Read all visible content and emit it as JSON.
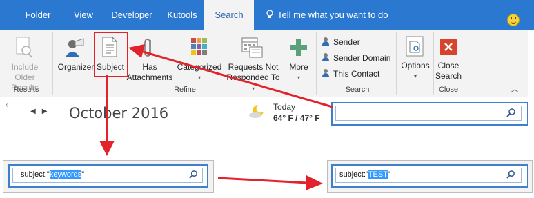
{
  "tabs": [
    {
      "label": "Folder",
      "active": false
    },
    {
      "label": "View",
      "active": false
    },
    {
      "label": "Developer",
      "active": false
    },
    {
      "label": "Kutools",
      "active": false
    },
    {
      "label": "Search",
      "active": true
    }
  ],
  "tell_me": "Tell me what you want to do",
  "results_group": {
    "label": "Results",
    "include_older": {
      "line1": "Include",
      "line2": "Older Results"
    }
  },
  "refine_group": {
    "label": "Refine",
    "organizer": "Organizer",
    "subject": "Subject",
    "has_attachments": {
      "line1": "Has",
      "line2": "Attachments"
    },
    "categorized": "Categorized",
    "requests_not_responded": {
      "line1": "Requests Not",
      "line2": "Responded To"
    },
    "more": "More"
  },
  "search_group": {
    "label": "Search",
    "sender": "Sender",
    "sender_domain": "Sender Domain",
    "this_contact": "This Contact"
  },
  "options_button": "Options",
  "close_group": {
    "label": "Close",
    "close_search": {
      "line1": "Close",
      "line2": "Search"
    }
  },
  "calendar": {
    "month": "October 2016"
  },
  "weather": {
    "today": "Today",
    "temps": "64° F / 47° F"
  },
  "search_examples": {
    "left": {
      "prefix": "subject:\"",
      "keyword": "keywords",
      "suffix": "\""
    },
    "right": {
      "prefix": "subject:\"",
      "keyword": "TEST",
      "suffix": "\""
    }
  },
  "colors": {
    "ribbon_blue": "#2b78d0",
    "highlight": "#3399ff",
    "annotation_red": "#e3232b"
  },
  "icons": [
    "include-older-results-icon",
    "organizer-icon",
    "subject-icon",
    "attachment-icon",
    "categorized-icon",
    "requests-not-responded-icon",
    "more-plus-icon",
    "sender-icon",
    "sender-domain-icon",
    "this-contact-icon",
    "options-icon",
    "close-search-icon",
    "lightbulb-icon",
    "smiley-icon",
    "weather-icon",
    "search-icon"
  ]
}
